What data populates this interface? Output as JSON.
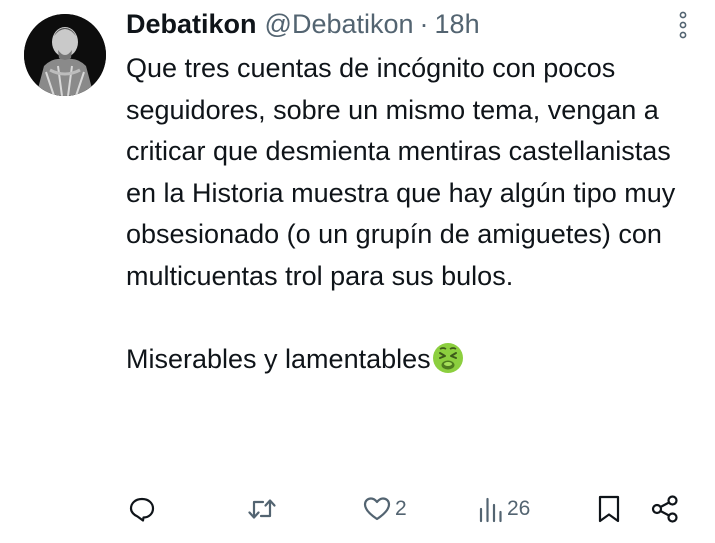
{
  "tweet": {
    "display_name": "Debatikon",
    "handle": "@Debatikon",
    "separator": "·",
    "time": "18h",
    "paragraph1": "Que tres cuentas de incógnito con pocos seguidores, sobre un mismo tema, vengan a criticar que desmienta mentiras castellanistas en la Historia muestra que hay algún tipo muy obsesionado (o un grupín de amiguetes) con multicuentas trol para sus bulos.",
    "paragraph2": "Miserables y lamentables",
    "emoji": "nauseated-face-emoji"
  },
  "actions": {
    "reply": {
      "icon": "reply-icon",
      "count": ""
    },
    "retweet": {
      "icon": "retweet-icon",
      "count": ""
    },
    "like": {
      "icon": "heart-icon",
      "count": "2"
    },
    "views": {
      "icon": "views-icon",
      "count": "26"
    },
    "bookmark": {
      "icon": "bookmark-icon"
    },
    "share": {
      "icon": "share-icon"
    }
  },
  "colors": {
    "text": "#0f1419",
    "secondary": "#536471",
    "background": "#ffffff"
  }
}
